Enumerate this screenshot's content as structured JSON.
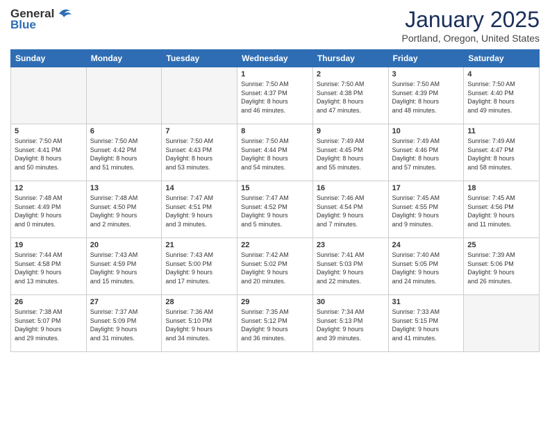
{
  "header": {
    "logo_general": "General",
    "logo_blue": "Blue",
    "month": "January 2025",
    "location": "Portland, Oregon, United States"
  },
  "weekdays": [
    "Sunday",
    "Monday",
    "Tuesday",
    "Wednesday",
    "Thursday",
    "Friday",
    "Saturday"
  ],
  "weeks": [
    [
      {
        "day": "",
        "info": ""
      },
      {
        "day": "",
        "info": ""
      },
      {
        "day": "",
        "info": ""
      },
      {
        "day": "1",
        "info": "Sunrise: 7:50 AM\nSunset: 4:37 PM\nDaylight: 8 hours\nand 46 minutes."
      },
      {
        "day": "2",
        "info": "Sunrise: 7:50 AM\nSunset: 4:38 PM\nDaylight: 8 hours\nand 47 minutes."
      },
      {
        "day": "3",
        "info": "Sunrise: 7:50 AM\nSunset: 4:39 PM\nDaylight: 8 hours\nand 48 minutes."
      },
      {
        "day": "4",
        "info": "Sunrise: 7:50 AM\nSunset: 4:40 PM\nDaylight: 8 hours\nand 49 minutes."
      }
    ],
    [
      {
        "day": "5",
        "info": "Sunrise: 7:50 AM\nSunset: 4:41 PM\nDaylight: 8 hours\nand 50 minutes."
      },
      {
        "day": "6",
        "info": "Sunrise: 7:50 AM\nSunset: 4:42 PM\nDaylight: 8 hours\nand 51 minutes."
      },
      {
        "day": "7",
        "info": "Sunrise: 7:50 AM\nSunset: 4:43 PM\nDaylight: 8 hours\nand 53 minutes."
      },
      {
        "day": "8",
        "info": "Sunrise: 7:50 AM\nSunset: 4:44 PM\nDaylight: 8 hours\nand 54 minutes."
      },
      {
        "day": "9",
        "info": "Sunrise: 7:49 AM\nSunset: 4:45 PM\nDaylight: 8 hours\nand 55 minutes."
      },
      {
        "day": "10",
        "info": "Sunrise: 7:49 AM\nSunset: 4:46 PM\nDaylight: 8 hours\nand 57 minutes."
      },
      {
        "day": "11",
        "info": "Sunrise: 7:49 AM\nSunset: 4:47 PM\nDaylight: 8 hours\nand 58 minutes."
      }
    ],
    [
      {
        "day": "12",
        "info": "Sunrise: 7:48 AM\nSunset: 4:49 PM\nDaylight: 9 hours\nand 0 minutes."
      },
      {
        "day": "13",
        "info": "Sunrise: 7:48 AM\nSunset: 4:50 PM\nDaylight: 9 hours\nand 2 minutes."
      },
      {
        "day": "14",
        "info": "Sunrise: 7:47 AM\nSunset: 4:51 PM\nDaylight: 9 hours\nand 3 minutes."
      },
      {
        "day": "15",
        "info": "Sunrise: 7:47 AM\nSunset: 4:52 PM\nDaylight: 9 hours\nand 5 minutes."
      },
      {
        "day": "16",
        "info": "Sunrise: 7:46 AM\nSunset: 4:54 PM\nDaylight: 9 hours\nand 7 minutes."
      },
      {
        "day": "17",
        "info": "Sunrise: 7:45 AM\nSunset: 4:55 PM\nDaylight: 9 hours\nand 9 minutes."
      },
      {
        "day": "18",
        "info": "Sunrise: 7:45 AM\nSunset: 4:56 PM\nDaylight: 9 hours\nand 11 minutes."
      }
    ],
    [
      {
        "day": "19",
        "info": "Sunrise: 7:44 AM\nSunset: 4:58 PM\nDaylight: 9 hours\nand 13 minutes."
      },
      {
        "day": "20",
        "info": "Sunrise: 7:43 AM\nSunset: 4:59 PM\nDaylight: 9 hours\nand 15 minutes."
      },
      {
        "day": "21",
        "info": "Sunrise: 7:43 AM\nSunset: 5:00 PM\nDaylight: 9 hours\nand 17 minutes."
      },
      {
        "day": "22",
        "info": "Sunrise: 7:42 AM\nSunset: 5:02 PM\nDaylight: 9 hours\nand 20 minutes."
      },
      {
        "day": "23",
        "info": "Sunrise: 7:41 AM\nSunset: 5:03 PM\nDaylight: 9 hours\nand 22 minutes."
      },
      {
        "day": "24",
        "info": "Sunrise: 7:40 AM\nSunset: 5:05 PM\nDaylight: 9 hours\nand 24 minutes."
      },
      {
        "day": "25",
        "info": "Sunrise: 7:39 AM\nSunset: 5:06 PM\nDaylight: 9 hours\nand 26 minutes."
      }
    ],
    [
      {
        "day": "26",
        "info": "Sunrise: 7:38 AM\nSunset: 5:07 PM\nDaylight: 9 hours\nand 29 minutes."
      },
      {
        "day": "27",
        "info": "Sunrise: 7:37 AM\nSunset: 5:09 PM\nDaylight: 9 hours\nand 31 minutes."
      },
      {
        "day": "28",
        "info": "Sunrise: 7:36 AM\nSunset: 5:10 PM\nDaylight: 9 hours\nand 34 minutes."
      },
      {
        "day": "29",
        "info": "Sunrise: 7:35 AM\nSunset: 5:12 PM\nDaylight: 9 hours\nand 36 minutes."
      },
      {
        "day": "30",
        "info": "Sunrise: 7:34 AM\nSunset: 5:13 PM\nDaylight: 9 hours\nand 39 minutes."
      },
      {
        "day": "31",
        "info": "Sunrise: 7:33 AM\nSunset: 5:15 PM\nDaylight: 9 hours\nand 41 minutes."
      },
      {
        "day": "",
        "info": ""
      }
    ]
  ]
}
